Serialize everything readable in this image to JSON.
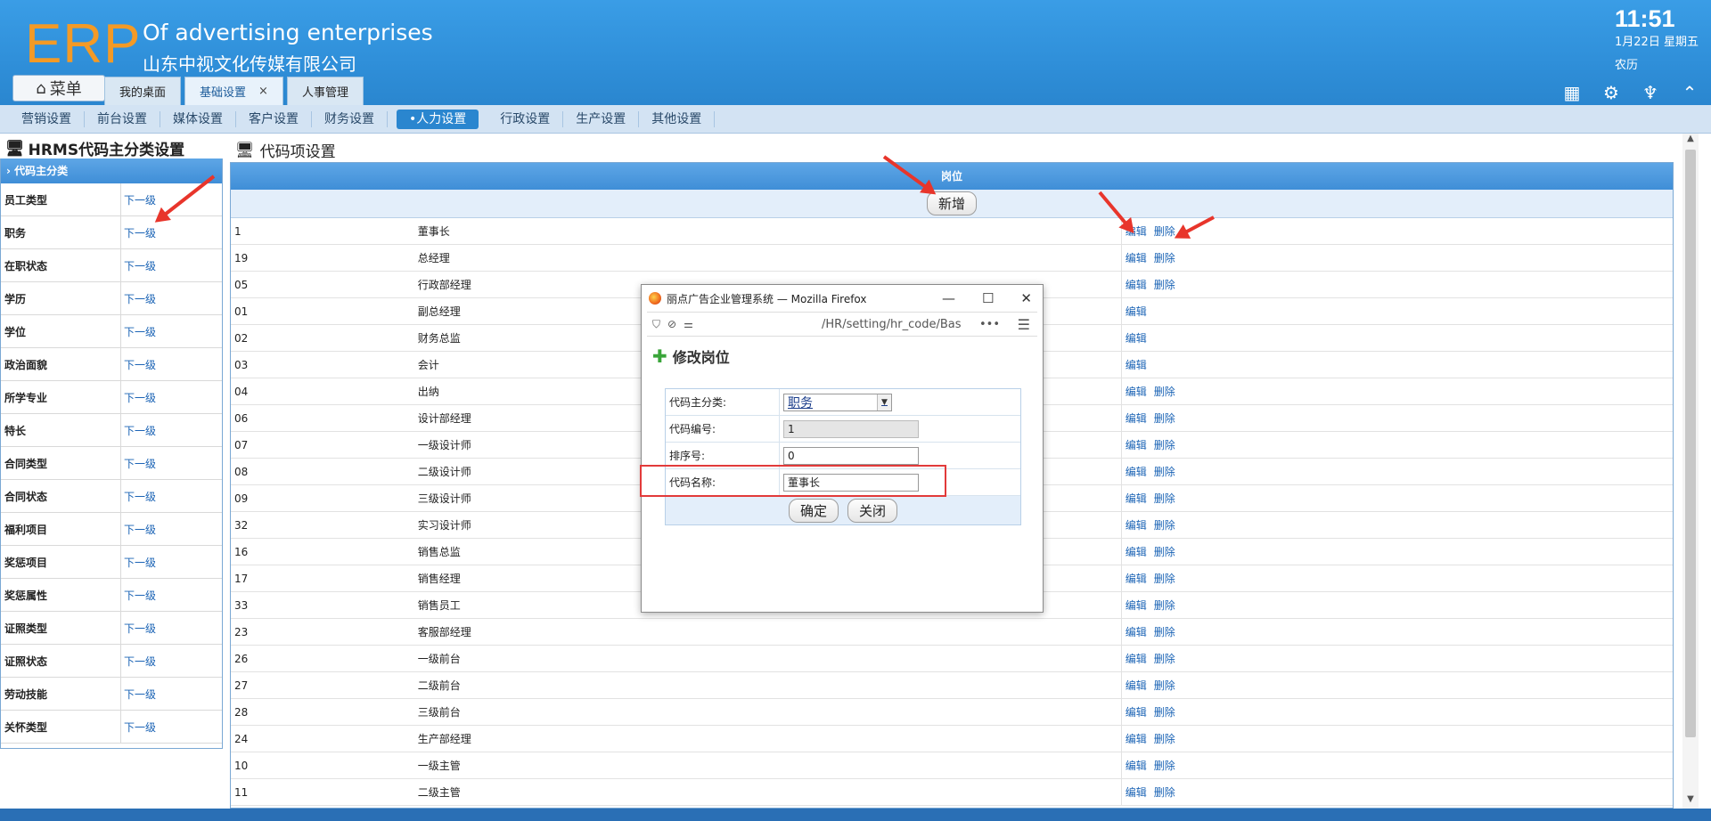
{
  "header": {
    "logo": "ERP",
    "company_en": "Of advertising enterprises",
    "company_cn": "山东中视文化传媒有限公司",
    "time": "11:51",
    "date": "1月22日 星期五",
    "lunar": "农历",
    "menu_label": "菜单"
  },
  "tabs": [
    {
      "label": "我的桌面"
    },
    {
      "label": "基础设置",
      "close": "×"
    },
    {
      "label": "人事管理"
    }
  ],
  "subnav": [
    "营销设置",
    "前台设置",
    "媒体设置",
    "客户设置",
    "财务设置",
    "•人力设置",
    "行政设置",
    "生产设置",
    "其他设置"
  ],
  "left": {
    "title": "HRMS代码主分类设置",
    "head": "代码主分类",
    "link": "下一级",
    "items": [
      "员工类型",
      "职务",
      "在职状态",
      "学历",
      "学位",
      "政治面貌",
      "所学专业",
      "特长",
      "合同类型",
      "合同状态",
      "福利项目",
      "奖惩项目",
      "奖惩属性",
      "证照类型",
      "证照状态",
      "劳动技能",
      "关怀类型"
    ]
  },
  "right": {
    "title": "代码项设置",
    "head": "岗位",
    "add_label": "新增",
    "edit": "编辑",
    "delete": "删除",
    "rows": [
      {
        "code": "1",
        "name": "董事长",
        "del": true
      },
      {
        "code": "19",
        "name": "总经理",
        "del": true
      },
      {
        "code": "05",
        "name": "行政部经理",
        "del": true
      },
      {
        "code": "01",
        "name": "副总经理",
        "del": false
      },
      {
        "code": "02",
        "name": "财务总监",
        "del": false
      },
      {
        "code": "03",
        "name": "会计",
        "del": false
      },
      {
        "code": "04",
        "name": "出纳",
        "del": true
      },
      {
        "code": "06",
        "name": "设计部经理",
        "del": true
      },
      {
        "code": "07",
        "name": "一级设计师",
        "del": true
      },
      {
        "code": "08",
        "name": "二级设计师",
        "del": true
      },
      {
        "code": "09",
        "name": "三级设计师",
        "del": true
      },
      {
        "code": "32",
        "name": "实习设计师",
        "del": true
      },
      {
        "code": "16",
        "name": "销售总监",
        "del": true
      },
      {
        "code": "17",
        "name": "销售经理",
        "del": true
      },
      {
        "code": "33",
        "name": "销售员工",
        "del": true
      },
      {
        "code": "23",
        "name": "客服部经理",
        "del": true
      },
      {
        "code": "26",
        "name": "一级前台",
        "del": true
      },
      {
        "code": "27",
        "name": "二级前台",
        "del": true
      },
      {
        "code": "28",
        "name": "三级前台",
        "del": true
      },
      {
        "code": "24",
        "name": "生产部经理",
        "del": true
      },
      {
        "code": "10",
        "name": "一级主管",
        "del": true
      },
      {
        "code": "11",
        "name": "二级主管",
        "del": true
      }
    ]
  },
  "popup": {
    "window_title": "丽点广告企业管理系统 — Mozilla Firefox",
    "url_path": "/HR/setting/hr_code/Bas",
    "dots": "•••",
    "heading": "修改岗位",
    "fields": [
      {
        "label": "代码主分类:",
        "value": "职务"
      },
      {
        "label": "代码编号:",
        "value": "1"
      },
      {
        "label": "排序号:",
        "value": "0"
      },
      {
        "label": "代码名称:",
        "value": "董事长"
      }
    ],
    "ok_label": "确定",
    "close_label": "关闭"
  }
}
